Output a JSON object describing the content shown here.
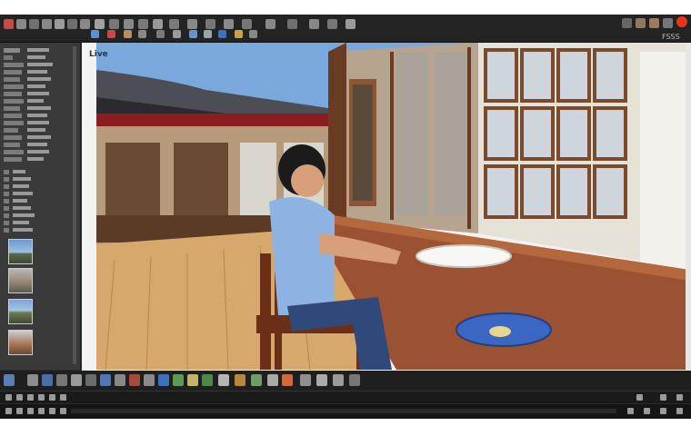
{
  "app": {
    "title_text": "FSSS",
    "viewport_label": "Live"
  },
  "colors": {
    "toolbar_bg": "#232323",
    "panel_bg": "#3a3a3a",
    "close_button": "#e8331f",
    "viewport_bg": "#f2f2f2"
  },
  "toolbar": {
    "icons": [
      "new-file-icon",
      "open-icon",
      "save-icon",
      "undo-icon",
      "redo-icon",
      "cut-icon",
      "copy-icon",
      "paste-icon",
      "select-icon",
      "move-icon",
      "rotate-icon",
      "scale-icon",
      "pen-icon",
      "brush-icon",
      "eraser-icon",
      "fill-icon",
      "text-icon",
      "shape-icon",
      "camera-icon",
      "light-icon",
      "grid-icon",
      "snap-icon",
      "render-icon",
      "settings-icon"
    ]
  },
  "window_buttons": [
    "minimize-icon",
    "restore-icon",
    "help-icon",
    "settings-icon",
    "close-icon"
  ],
  "left_panel": {
    "thumbnails": [
      "scene-thumbnail-1",
      "scene-thumbnail-2",
      "scene-thumbnail-3",
      "scene-thumbnail-4",
      "scene-thumbnail-5",
      "scene-thumbnail-6"
    ]
  },
  "bottom_toolbar": {
    "icons": [
      "image-icon",
      "layers-icon",
      "color-icon",
      "texture-icon",
      "material-icon",
      "palette-icon",
      "eyedropper-icon",
      "swatch-icon",
      "frame-icon",
      "crop-icon",
      "filter-icon",
      "adjust-icon",
      "mask-icon",
      "export-icon",
      "share-icon",
      "print-icon"
    ]
  }
}
